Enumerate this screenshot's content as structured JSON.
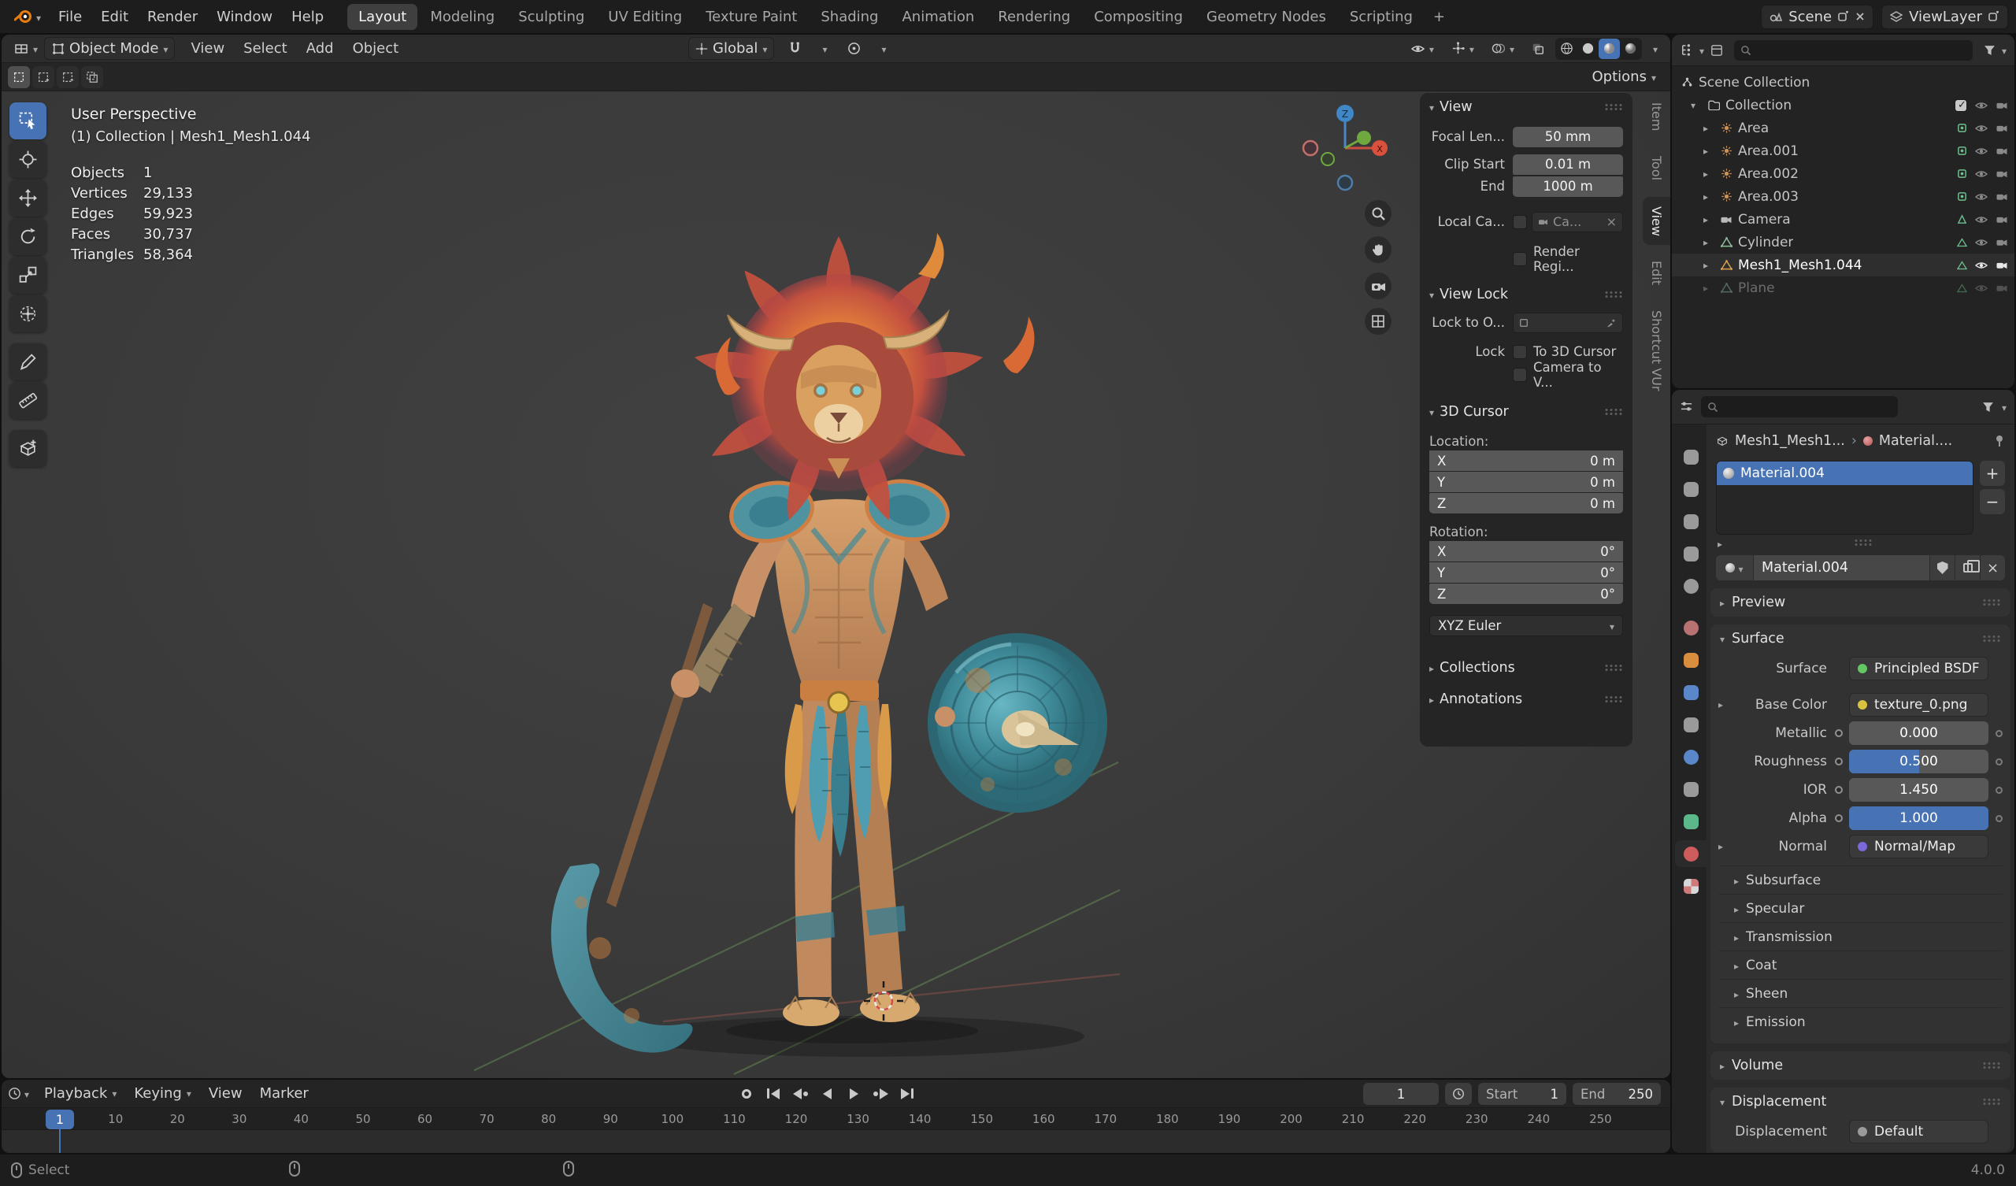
{
  "topbar": {
    "menus": [
      "File",
      "Edit",
      "Render",
      "Window",
      "Help"
    ],
    "workspaces": [
      {
        "label": "Layout",
        "active": true
      },
      {
        "label": "Modeling"
      },
      {
        "label": "Sculpting"
      },
      {
        "label": "UV Editing"
      },
      {
        "label": "Texture Paint"
      },
      {
        "label": "Shading"
      },
      {
        "label": "Animation"
      },
      {
        "label": "Rendering"
      },
      {
        "label": "Compositing"
      },
      {
        "label": "Geometry Nodes"
      },
      {
        "label": "Scripting"
      }
    ],
    "add_workspace": "+",
    "scene_label": "Scene",
    "view_layer_label": "ViewLayer"
  },
  "viewport_header": {
    "mode": "Object Mode",
    "menus": [
      "View",
      "Select",
      "Add",
      "Object"
    ],
    "orientation": "Global",
    "options": "Options"
  },
  "viewport": {
    "perspective": "User Perspective",
    "context": "(1) Collection | Mesh1_Mesh1.044",
    "stats": [
      {
        "label": "Objects",
        "value": "1"
      },
      {
        "label": "Vertices",
        "value": "29,133"
      },
      {
        "label": "Edges",
        "value": "59,923"
      },
      {
        "label": "Faces",
        "value": "30,737"
      },
      {
        "label": "Triangles",
        "value": "58,364"
      }
    ],
    "gizmo_axes": {
      "x": "X",
      "z": "Z"
    },
    "sidebar_tabs": [
      {
        "label": "Item"
      },
      {
        "label": "Tool"
      },
      {
        "label": "View",
        "active": true
      },
      {
        "label": "Edit"
      },
      {
        "label": "Shortcut VUr"
      }
    ]
  },
  "npanel": {
    "view": {
      "title": "View",
      "focal_label": "Focal Len...",
      "focal_value": "50 mm",
      "clip_start_label": "Clip Start",
      "clip_start_value": "0.01 m",
      "clip_end_label": "End",
      "clip_end_value": "1000 m",
      "local_camera_label": "Local Ca...",
      "local_camera_value": "Ca...",
      "render_region_label": "Render Regi..."
    },
    "view_lock": {
      "title": "View Lock",
      "lock_object_label": "Lock to O...",
      "lock_label": "Lock",
      "to_3d_cursor_label": "To 3D Cursor",
      "camera_to_view_label": "Camera to V..."
    },
    "cursor": {
      "title": "3D Cursor",
      "location_label": "Location:",
      "rotation_label": "Rotation:",
      "location": [
        {
          "axis": "X",
          "value": "0 m"
        },
        {
          "axis": "Y",
          "value": "0 m"
        },
        {
          "axis": "Z",
          "value": "0 m"
        }
      ],
      "rotation": [
        {
          "axis": "X",
          "value": "0°"
        },
        {
          "axis": "Y",
          "value": "0°"
        },
        {
          "axis": "Z",
          "value": "0°"
        }
      ],
      "order": "XYZ Euler"
    },
    "collections_title": "Collections",
    "annotations_title": "Annotations"
  },
  "outliner": {
    "root_label": "Scene Collection",
    "collection_label": "Collection",
    "items": [
      {
        "label": "Area",
        "icon": "light"
      },
      {
        "label": "Area.001",
        "icon": "light"
      },
      {
        "label": "Area.002",
        "icon": "light"
      },
      {
        "label": "Area.003",
        "icon": "light"
      },
      {
        "label": "Camera",
        "icon": "camera"
      },
      {
        "label": "Cylinder",
        "icon": "mesh"
      },
      {
        "label": "Mesh1_Mesh1.044",
        "icon": "mesh",
        "selected": true
      },
      {
        "label": "Plane",
        "icon": "mesh",
        "dimmed": true
      }
    ]
  },
  "properties": {
    "nav": [
      {
        "name": "tool",
        "color": "#9a9a9a"
      },
      {
        "name": "render",
        "color": "#9a9a9a"
      },
      {
        "name": "output",
        "color": "#9a9a9a"
      },
      {
        "name": "view-layer",
        "color": "#9a9a9a"
      },
      {
        "name": "scene",
        "color": "#9a9a9a"
      },
      {
        "name": "world",
        "color": "#b87272"
      },
      {
        "name": "object",
        "color": "#d98d3e"
      },
      {
        "name": "modifiers",
        "color": "#5a87c9"
      },
      {
        "name": "particles",
        "color": "#9a9a9a"
      },
      {
        "name": "physics",
        "color": "#5a87c9"
      },
      {
        "name": "constraints",
        "color": "#9a9a9a"
      },
      {
        "name": "data",
        "color": "#5cb88a"
      },
      {
        "name": "material",
        "color": "#cf5c5c",
        "active": true
      },
      {
        "name": "texture",
        "color": "#cf7a7a"
      }
    ],
    "breadcrumb_object": "Mesh1_Mesh1...",
    "breadcrumb_data": "Material....",
    "slot_name": "Material.004",
    "datablock_name": "Material.004",
    "preview_title": "Preview",
    "surface_title": "Surface",
    "surface_label": "Surface",
    "surface_value": "Principled BSDF",
    "base_color_label": "Base Color",
    "base_color_value": "texture_0.png",
    "sliders": [
      {
        "label": "Metallic",
        "value": "0.000",
        "fill": 0
      },
      {
        "label": "Roughness",
        "value": "0.500",
        "fill": 0.5
      },
      {
        "label": "IOR",
        "value": "1.450",
        "fill": 0
      },
      {
        "label": "Alpha",
        "value": "1.000",
        "fill": 1
      }
    ],
    "normal_label": "Normal",
    "normal_value": "Normal/Map",
    "subpanels": [
      "Subsurface",
      "Specular",
      "Transmission",
      "Coat",
      "Sheen",
      "Emission"
    ],
    "volume_title": "Volume",
    "displacement_title": "Displacement",
    "displacement_label": "Displacement",
    "displacement_value": "Default"
  },
  "timeline": {
    "menus": [
      {
        "label": "Playback",
        "caret": true
      },
      {
        "label": "Keying",
        "caret": true
      },
      {
        "label": "View"
      },
      {
        "label": "Marker"
      }
    ],
    "current_frame": "1",
    "playhead_frame": "1",
    "start_label": "Start",
    "start_value": "1",
    "end_label": "End",
    "end_value": "250",
    "ruler_frames": [
      1,
      10,
      20,
      30,
      40,
      50,
      60,
      70,
      80,
      90,
      100,
      110,
      120,
      130,
      140,
      150,
      160,
      170,
      180,
      190,
      200,
      210,
      220,
      230,
      240,
      250
    ]
  },
  "statusbar": {
    "select_label": "Select",
    "version": "4.0.0"
  }
}
